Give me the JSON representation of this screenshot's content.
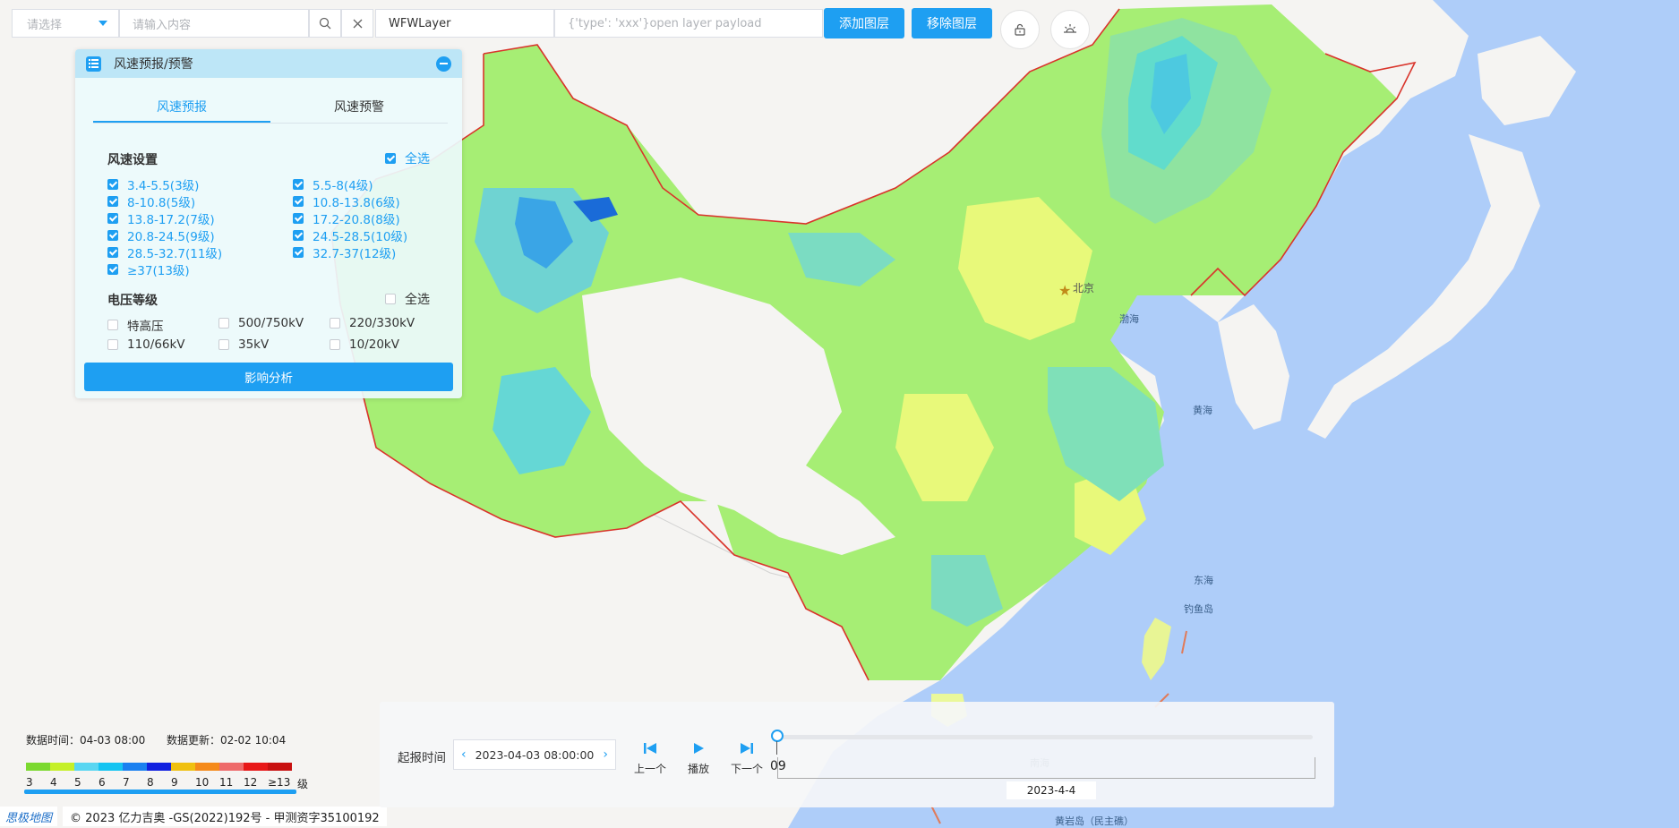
{
  "toolbar": {
    "select_placeholder": "请选择",
    "search_placeholder": "请输入内容",
    "layer_name": "WFWLayer",
    "payload_placeholder": "{'type': 'xxx'}open layer payload",
    "add_layer_label": "添加图层",
    "remove_layer_label": "移除图层"
  },
  "map": {
    "labels": {
      "beijing": "北京",
      "bohai": "渤海",
      "huanghai": "黄海",
      "donghai": "东海",
      "diaoyudao": "钓鱼岛",
      "huangyandao": "黄岩岛（民主礁）",
      "nanhai": "南海"
    },
    "colors": {
      "border": "#d9342b",
      "sea": "#aecdf9",
      "land": "#f5f4f2"
    }
  },
  "panel": {
    "title": "风速预报/预警",
    "tabs": [
      {
        "label": "风速预报",
        "active": true
      },
      {
        "label": "风速预警",
        "active": false
      }
    ],
    "wind": {
      "title": "风速设置",
      "select_all": "全选",
      "select_all_checked": true,
      "items": [
        {
          "label": "3.4-5.5(3级)",
          "checked": true
        },
        {
          "label": "5.5-8(4级)",
          "checked": true
        },
        {
          "label": "8-10.8(5级)",
          "checked": true
        },
        {
          "label": "10.8-13.8(6级)",
          "checked": true
        },
        {
          "label": "13.8-17.2(7级)",
          "checked": true
        },
        {
          "label": "17.2-20.8(8级)",
          "checked": true
        },
        {
          "label": "20.8-24.5(9级)",
          "checked": true
        },
        {
          "label": "24.5-28.5(10级)",
          "checked": true
        },
        {
          "label": "28.5-32.7(11级)",
          "checked": true
        },
        {
          "label": "32.7-37(12级)",
          "checked": true
        },
        {
          "label": "≥37(13级)",
          "checked": true
        }
      ]
    },
    "voltage": {
      "title": "电压等级",
      "select_all": "全选",
      "select_all_checked": false,
      "items": [
        {
          "label": "特高压",
          "checked": false
        },
        {
          "label": "500/750kV",
          "checked": false
        },
        {
          "label": "220/330kV",
          "checked": false
        },
        {
          "label": "110/66kV",
          "checked": false
        },
        {
          "label": "35kV",
          "checked": false
        },
        {
          "label": "10/20kV",
          "checked": false
        }
      ]
    },
    "analyze_label": "影响分析"
  },
  "legend": {
    "data_time": "数据时间：04-03 08:00",
    "data_update": "数据更新：02-02 10:04",
    "colors": [
      "#7bd92f",
      "#c5f028",
      "#59d6f2",
      "#14c4f2",
      "#1a80f0",
      "#1020e0",
      "#f0c010",
      "#f58a1a",
      "#ee6a6a",
      "#e81818",
      "#c81010"
    ],
    "labels": [
      "3",
      "4",
      "5",
      "6",
      "7",
      "8",
      "9",
      "10",
      "11",
      "12",
      "≥13"
    ],
    "unit": "级"
  },
  "copyright": {
    "logo": "思极地图",
    "text": "© 2023 亿力吉奥 -GS(2022)192号 - 甲测资字35100192"
  },
  "timeline": {
    "label": "起报时间",
    "date_value": "2023-04-03 08:00:00",
    "prev_label": "上一个",
    "play_label": "播放",
    "next_label": "下一个",
    "current_hour": "09",
    "progress": 0,
    "day_tag": "2023-4-4"
  }
}
